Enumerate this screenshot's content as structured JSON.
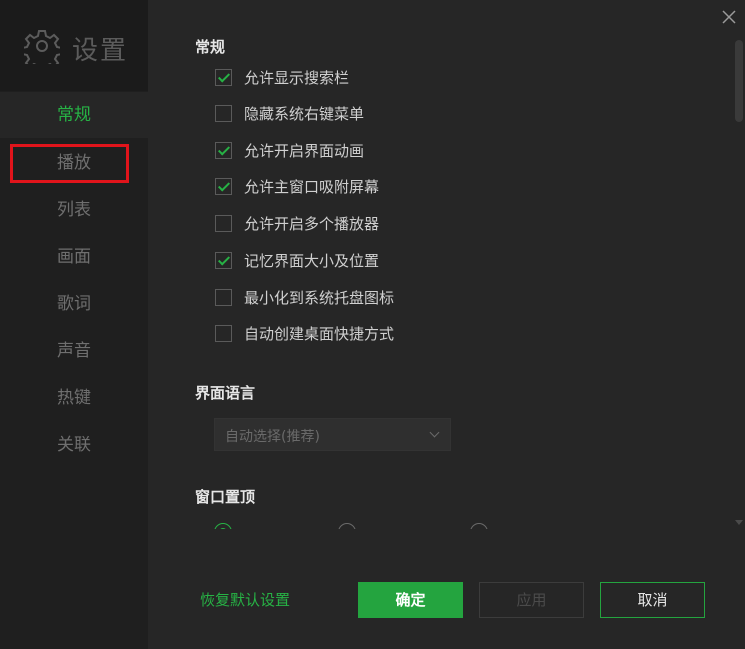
{
  "sidebar": {
    "title": "设置",
    "items": [
      {
        "label": "常规",
        "active": true
      },
      {
        "label": "播放",
        "active": false
      },
      {
        "label": "列表",
        "active": false
      },
      {
        "label": "画面",
        "active": false
      },
      {
        "label": "歌词",
        "active": false
      },
      {
        "label": "声音",
        "active": false
      },
      {
        "label": "热键",
        "active": false
      },
      {
        "label": "关联",
        "active": false
      }
    ]
  },
  "general": {
    "title": "常规",
    "options": [
      {
        "label": "允许显示搜索栏",
        "checked": true
      },
      {
        "label": "隐藏系统右键菜单",
        "checked": false
      },
      {
        "label": "允许开启界面动画",
        "checked": true
      },
      {
        "label": "允许主窗口吸附屏幕",
        "checked": true
      },
      {
        "label": "允许开启多个播放器",
        "checked": false
      },
      {
        "label": "记忆界面大小及位置",
        "checked": true
      },
      {
        "label": "最小化到系统托盘图标",
        "checked": false
      },
      {
        "label": "自动创建桌面快捷方式",
        "checked": false
      }
    ]
  },
  "language": {
    "title": "界面语言",
    "selected": "自动选择(推荐)"
  },
  "window_top": {
    "title": "窗口置顶"
  },
  "footer": {
    "restore_label": "恢复默认设置",
    "ok_label": "确定",
    "apply_label": "应用",
    "cancel_label": "取消"
  },
  "colors": {
    "accent": "#27b245",
    "highlight": "#e0141b",
    "background": "#262626",
    "sidebar": "#1f1f1f"
  },
  "icons": {
    "settings": "gear-icon",
    "close": "close-icon",
    "dropdown": "chevron-down-icon"
  }
}
